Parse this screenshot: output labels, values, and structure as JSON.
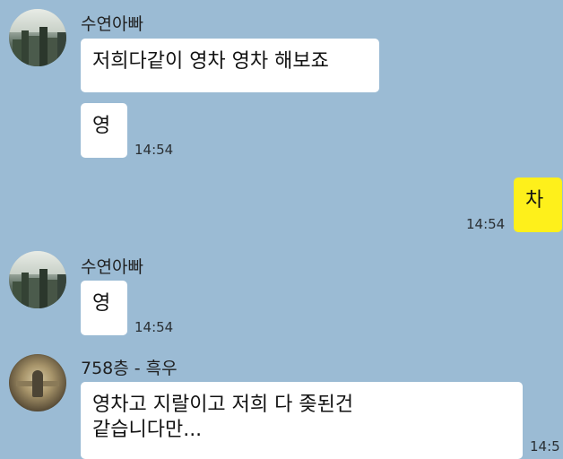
{
  "app": {
    "background_color": "#9bbbd4"
  },
  "messages": [
    {
      "sender": "수연아빠",
      "text": "저희다같이 영차 영차 해보죠",
      "time": ""
    },
    {
      "sender": "수연아빠",
      "text": "영",
      "time": "14:54"
    },
    {
      "sender": "me",
      "text": "차",
      "time": "14:54",
      "bubble_color": "#fef01b"
    },
    {
      "sender": "수연아빠",
      "text": "영",
      "time": "14:54"
    },
    {
      "sender": "758층 - 흑우",
      "text_line1": "영차고 지랄이고 저희 다 좆된건",
      "text_line2": "같습니다만...",
      "time": "14:5"
    }
  ],
  "icons": {
    "avatar_1": "profile-photo-city-icon",
    "avatar_2": "profile-photo-city-icon",
    "avatar_3": "profile-photo-person-icon"
  }
}
